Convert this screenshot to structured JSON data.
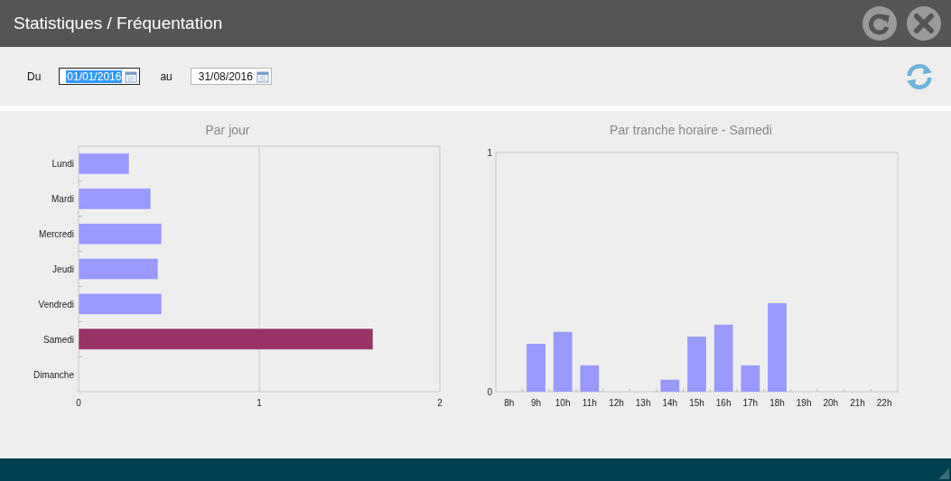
{
  "window": {
    "title": "Statistiques / Fréquentation"
  },
  "filters": [
    {
      "label": "Du",
      "value": "01/01/2016",
      "focused": true
    },
    {
      "label": "au",
      "value": "31/08/2016",
      "focused": false
    }
  ],
  "charts": [
    {
      "chart_data": {
        "type": "bar",
        "orientation": "horizontal",
        "title": "Par jour",
        "categories": [
          "Lundi",
          "Mardi",
          "Mercredi",
          "Jeudi",
          "Vendredi",
          "Samedi",
          "Dimanche"
        ],
        "xlim": [
          0,
          2
        ],
        "xticks": [
          0,
          1,
          2
        ],
        "series": [
          {
            "color": "#9999ff",
            "values": [
              0.28,
              0.4,
              0.46,
              0.44,
              0.46,
              null,
              0
            ]
          },
          {
            "color": "#993366",
            "values": [
              null,
              null,
              null,
              null,
              null,
              1.63,
              null
            ]
          }
        ]
      }
    },
    {
      "chart_data": {
        "type": "bar",
        "title": "Par tranche horaire - Samedi",
        "categories": [
          "8h",
          "9h",
          "10h",
          "11h",
          "12h",
          "13h",
          "14h",
          "15h",
          "16h",
          "17h",
          "18h",
          "19h",
          "20h",
          "21h",
          "22h"
        ],
        "ylim": [
          0,
          1
        ],
        "yticks": [
          0,
          1
        ],
        "series": [
          {
            "color": "#9999ff",
            "values": [
              0,
              0.2,
              0.25,
              0.11,
              0,
              0,
              0.05,
              0.23,
              0.28,
              0.11,
              0.37,
              0,
              0,
              0,
              0
            ]
          }
        ]
      }
    }
  ]
}
